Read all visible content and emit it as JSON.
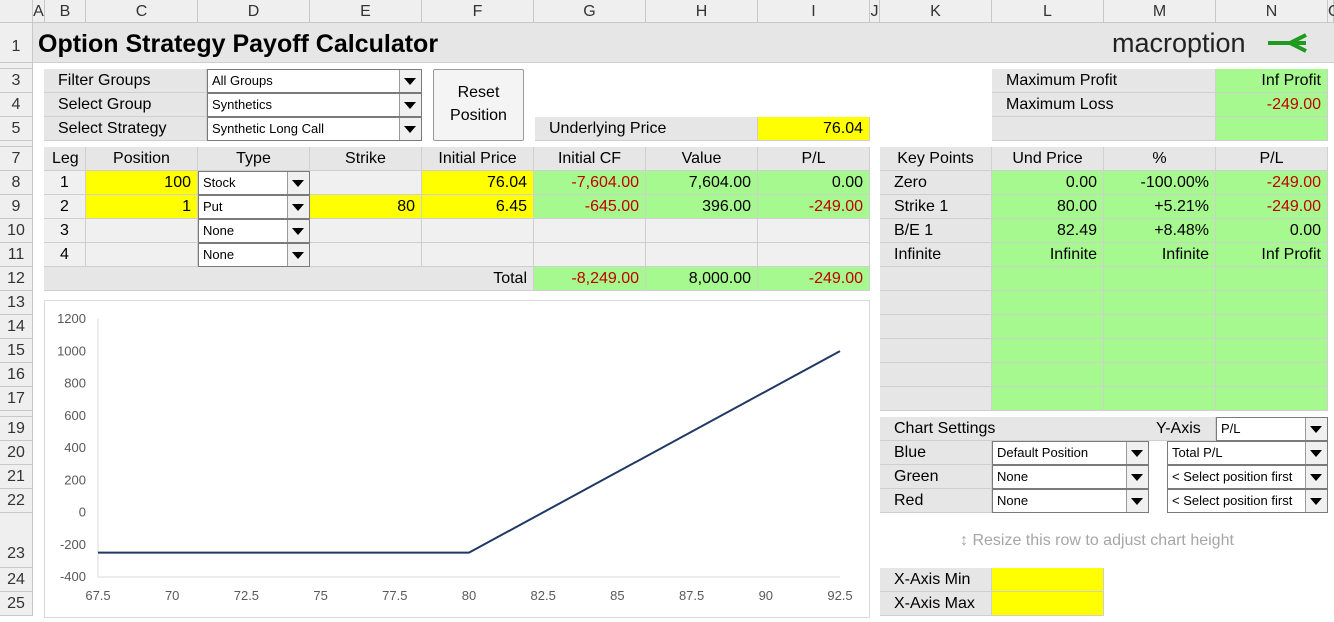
{
  "columns": [
    "A",
    "B",
    "C",
    "D",
    "E",
    "F",
    "G",
    "H",
    "I",
    "J",
    "K",
    "L",
    "M",
    "N",
    "O"
  ],
  "rows": [
    "1",
    "3",
    "4",
    "5",
    "7",
    "8",
    "9",
    "10",
    "11",
    "12",
    "13",
    "14",
    "15",
    "16",
    "17",
    "19",
    "20",
    "21",
    "22",
    "23",
    "24",
    "25"
  ],
  "title": "Option Strategy Payoff Calculator",
  "logo": "macroption",
  "filters": {
    "filter_groups_label": "Filter Groups",
    "filter_groups_value": "All Groups",
    "select_group_label": "Select Group",
    "select_group_value": "Synthetics",
    "select_strategy_label": "Select Strategy",
    "select_strategy_value": "Synthetic Long Call"
  },
  "reset_button": {
    "line1": "Reset",
    "line2": "Position"
  },
  "underlying": {
    "label": "Underlying Price",
    "value": "76.04"
  },
  "summary": {
    "max_profit_label": "Maximum Profit",
    "max_profit_value": "Inf Profit",
    "max_loss_label": "Maximum Loss",
    "max_loss_value": "-249.00"
  },
  "legs_table": {
    "headers": [
      "Leg",
      "Position",
      "Type",
      "Strike",
      "Initial Price",
      "Initial CF",
      "Value",
      "P/L"
    ],
    "rows": [
      {
        "leg": "1",
        "position": "100",
        "type": "Stock",
        "strike": "",
        "initial_price": "76.04",
        "initial_cf": "-7,604.00",
        "value": "7,604.00",
        "pl": "0.00"
      },
      {
        "leg": "2",
        "position": "1",
        "type": "Put",
        "strike": "80",
        "initial_price": "6.45",
        "initial_cf": "-645.00",
        "value": "396.00",
        "pl": "-249.00"
      },
      {
        "leg": "3",
        "position": "",
        "type": "None",
        "strike": "",
        "initial_price": "",
        "initial_cf": "",
        "value": "",
        "pl": ""
      },
      {
        "leg": "4",
        "position": "",
        "type": "None",
        "strike": "",
        "initial_price": "",
        "initial_cf": "",
        "value": "",
        "pl": ""
      }
    ],
    "total": {
      "label": "Total",
      "initial_cf": "-8,249.00",
      "value": "8,000.00",
      "pl": "-249.00"
    }
  },
  "key_points": {
    "headers": [
      "Key Points",
      "Und Price",
      "%",
      "P/L"
    ],
    "rows": [
      {
        "name": "Zero",
        "price": "0.00",
        "pct": "-100.00%",
        "pl": "-249.00"
      },
      {
        "name": "Strike 1",
        "price": "80.00",
        "pct": "+5.21%",
        "pl": "-249.00"
      },
      {
        "name": "B/E 1",
        "price": "82.49",
        "pct": "+8.48%",
        "pl": "0.00"
      },
      {
        "name": "Infinite",
        "price": "Infinite",
        "pct": "Infinite",
        "pl": "Inf Profit"
      }
    ]
  },
  "chart_settings": {
    "title": "Chart Settings",
    "y_axis_label": "Y-Axis",
    "y_axis_value": "P/L",
    "blue_label": "Blue",
    "blue_value": "Default Position",
    "blue_metric": "Total P/L",
    "green_label": "Green",
    "green_value": "None",
    "green_metric": "< Select position first",
    "red_label": "Red",
    "red_value": "None",
    "red_metric": "< Select position first"
  },
  "resize_hint": "Resize this row to adjust chart height",
  "xaxis": {
    "min_label": "X-Axis Min",
    "max_label": "X-Axis Max"
  },
  "colors": {
    "line": "#1f3864",
    "green": "#a6f98f",
    "yellow": "#ffff00",
    "negative": "#c00000"
  },
  "chart_data": {
    "type": "line",
    "x_ticks": [
      "67.5",
      "70",
      "72.5",
      "75",
      "77.5",
      "80",
      "82.5",
      "85",
      "87.5",
      "90",
      "92.5"
    ],
    "y_ticks": [
      "1200",
      "1000",
      "800",
      "600",
      "400",
      "200",
      "0",
      "-200",
      "-400"
    ],
    "xlim": [
      67.5,
      92.5
    ],
    "ylim": [
      -400,
      1200
    ],
    "series": [
      {
        "x": [
          67.5,
          80,
          92.5
        ],
        "y": [
          -249,
          -249,
          1001
        ]
      }
    ]
  }
}
